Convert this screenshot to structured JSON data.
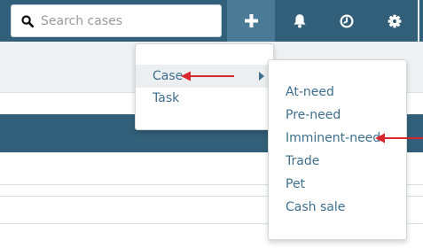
{
  "search": {
    "placeholder": "Search cases",
    "icon": "search-icon"
  },
  "toolbar": {
    "buttons": [
      {
        "name": "add-button",
        "icon": "plus-icon"
      },
      {
        "name": "notifications-button",
        "icon": "bell-icon"
      },
      {
        "name": "history-button",
        "icon": "clock-icon"
      },
      {
        "name": "settings-button",
        "icon": "gear-icon"
      }
    ]
  },
  "add_menu": {
    "items": [
      {
        "label": "Case",
        "has_submenu": true,
        "highlighted": true
      },
      {
        "label": "Task",
        "has_submenu": false,
        "highlighted": false
      }
    ]
  },
  "case_submenu": {
    "items": [
      {
        "label": "At-need"
      },
      {
        "label": "Pre-need"
      },
      {
        "label": "Imminent-need"
      },
      {
        "label": "Trade"
      },
      {
        "label": "Pet"
      },
      {
        "label": "Cash sale"
      }
    ]
  },
  "colors": {
    "topbar": "#325f79",
    "active_button": "#4a7a96",
    "menu_text": "#3e6f8d",
    "annotation_arrow": "#d9272e"
  }
}
